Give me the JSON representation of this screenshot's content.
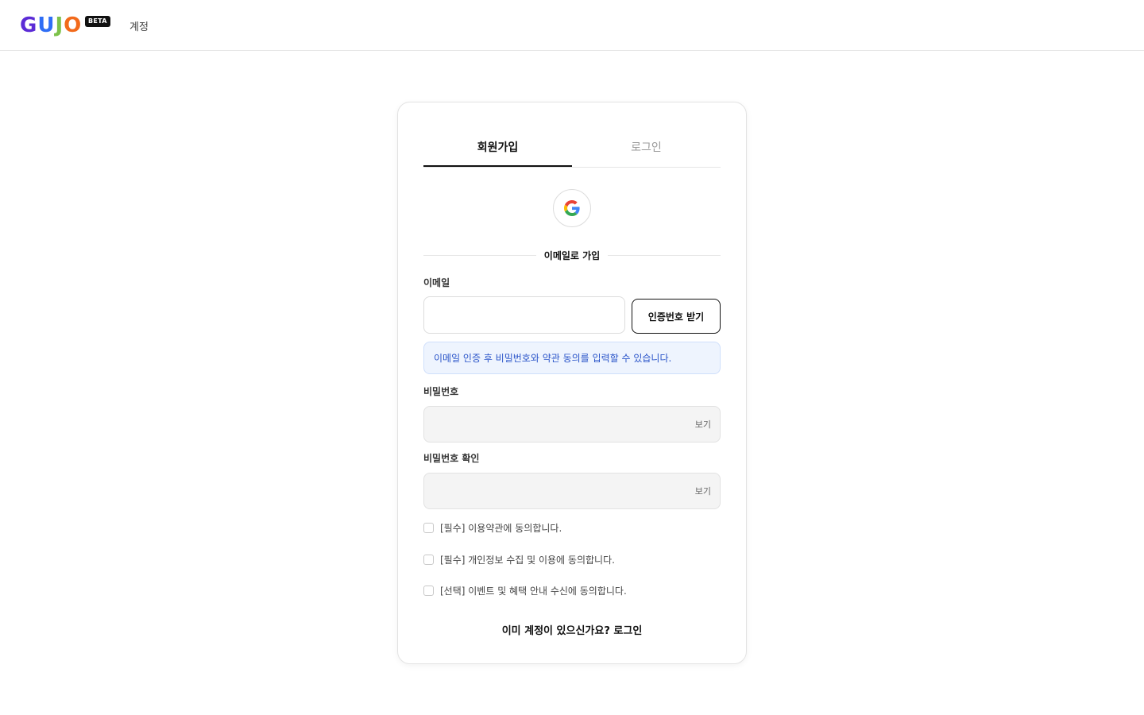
{
  "header": {
    "logo": {
      "letters": [
        {
          "char": "G",
          "color": "#5b2bd6"
        },
        {
          "char": "U",
          "color": "#2f6ef5"
        },
        {
          "char": "J",
          "color": "#7cc14a"
        },
        {
          "char": "O",
          "color": "#f26a1b"
        }
      ],
      "badge": "BETA"
    },
    "nav_account": "계정"
  },
  "tabs": [
    {
      "label": "회원가입",
      "active": true
    },
    {
      "label": "로그인",
      "active": false
    }
  ],
  "social": {
    "google_icon": "google-logo-icon"
  },
  "divider_label": "이메일로 가입",
  "email": {
    "label": "이메일",
    "value": "",
    "placeholder": "",
    "verify_button": "인증번호 받기"
  },
  "info_message": "이메일 인증 후 비밀번호와 약관 동의를 입력할 수 있습니다.",
  "password": {
    "label": "비밀번호",
    "toggle": "보기"
  },
  "password_confirm": {
    "label": "비밀번호 확인",
    "toggle": "보기"
  },
  "agreements": [
    {
      "label": "[필수] 이용약관에 동의합니다.",
      "checked": false
    },
    {
      "label": "[필수] 개인정보 수집 및 이용에 동의합니다.",
      "checked": false
    },
    {
      "label": "[선택] 이벤트 및 혜택 안내 수신에 동의합니다.",
      "checked": false
    }
  ],
  "footer_link": "이미 계정이 있으신가요? 로그인"
}
